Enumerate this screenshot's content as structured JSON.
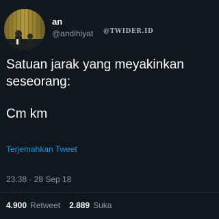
{
  "author": {
    "name": "an",
    "handle": "@andihiyat",
    "avatar_icon": "profile-photo-icon"
  },
  "watermark": "@TWIDER.ID",
  "tweet": {
    "text_line_1": "Satuan jarak yang meyakinkan\nseseorang:",
    "text_line_2": "Cm km",
    "translate_label": "Terjemahkan Tweet",
    "timestamp": "23:38 · 28 Sep 18"
  },
  "stats": {
    "retweet_count": "4.900",
    "retweet_label": "Retweet",
    "like_count": "2.889",
    "like_label": "Suka"
  },
  "colors": {
    "background": "#10171e",
    "link": "#1b95e0",
    "muted": "#8899a6"
  }
}
